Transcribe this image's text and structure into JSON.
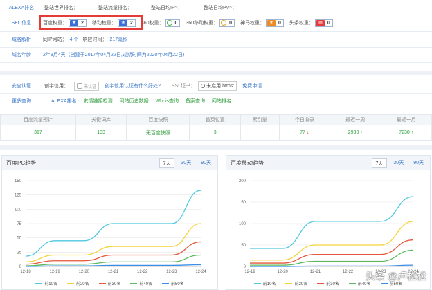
{
  "alexa": {
    "label": "ALEXA排名",
    "items": [
      "整站世界排名：",
      "整站流量排名：",
      "整站日均IP≈：",
      "整站日均PV≈："
    ]
  },
  "seo": {
    "label": "SEO信息",
    "baidu_label": "百度权重：",
    "baidu_value": "2",
    "mobile_label": "移动权重：",
    "mobile_value": "2",
    "so_label": "360权重：",
    "so_value": "0",
    "so_mobile_label": "360移动权重：",
    "so_mobile_value": "0",
    "shenma_label": "神马权重：",
    "shenma_value": "0",
    "toutiao_label": "头条权重：",
    "toutiao_value": "0"
  },
  "domain_parse": {
    "label": "域名解析",
    "same_ip_label": "同IP网站：",
    "same_ip_value": "4 个",
    "response_label": "响应时间：",
    "response_value": "217毫秒"
  },
  "domain_age": {
    "label": "域名年龄",
    "text": "2年8月4天（创建于2017年04月22日,过期时间为2020年04月22日)"
  },
  "security": {
    "label": "安全认证",
    "credit_label": "创宇信用：",
    "credit_badge": "未认证",
    "credit_link": "创宇信用认证有什么好处?",
    "ssl_label": "SSL证书：",
    "ssl_value": "未启用 https:",
    "ssl_apply": "免费申请"
  },
  "more": {
    "label": "更多查询",
    "links": [
      "ALEXA排名",
      "友情链接检测",
      "网站历史数据",
      "Whois查询",
      "备案查询",
      "网站排名"
    ]
  },
  "stats": {
    "headers": [
      "百度流量预计",
      "关键词库",
      "百度快照",
      "首页位置",
      "索引量",
      "今日收录",
      "最近一周",
      "最近一月"
    ],
    "values": [
      "317",
      "133",
      "无百度快照",
      "3",
      "-",
      "77",
      "2930",
      "7230"
    ]
  },
  "colors": {
    "s1": "#4fc8e0",
    "s2": "#f4d33b",
    "s3": "#e5563a",
    "s4": "#5cb85c",
    "s5": "#3a8ee6"
  },
  "pc_panel": {
    "title": "百度PC趋势",
    "tabs": [
      "7天",
      "30天",
      "90天"
    ]
  },
  "mobile_panel": {
    "title": "百度移动趋势",
    "tabs": [
      "7天",
      "30天",
      "90天"
    ]
  },
  "chart_data": [
    {
      "type": "line",
      "title": "百度PC趋势",
      "categories": [
        "12-18",
        "12-19",
        "12-20",
        "12-21",
        "12-22",
        "12-23",
        "12-24"
      ],
      "ylim": [
        0,
        150
      ],
      "yticks": [
        0,
        25,
        50,
        75,
        100,
        125,
        150
      ],
      "series": [
        {
          "name": "前10名",
          "values": [
            18,
            45,
            45,
            75,
            75,
            75,
            133
          ]
        },
        {
          "name": "前20名",
          "values": [
            8,
            20,
            20,
            35,
            35,
            35,
            75
          ]
        },
        {
          "name": "前30名",
          "values": [
            4,
            10,
            10,
            20,
            20,
            20,
            43
          ]
        },
        {
          "name": "前40名",
          "values": [
            1,
            4,
            4,
            8,
            8,
            8,
            20
          ]
        },
        {
          "name": "前50名",
          "values": [
            0,
            1,
            1,
            2,
            2,
            2,
            3
          ]
        }
      ]
    },
    {
      "type": "line",
      "title": "百度移动趋势",
      "categories": [
        "12-19",
        "12-20",
        "12-21",
        "12-22",
        "12-23",
        "12-24"
      ],
      "ylim": [
        0,
        200
      ],
      "yticks": [
        0,
        50,
        100,
        150,
        200
      ],
      "series": [
        {
          "name": "前10名",
          "values": [
            42,
            42,
            105,
            105,
            105,
            163
          ]
        },
        {
          "name": "前20名",
          "values": [
            15,
            15,
            50,
            50,
            50,
            105
          ]
        },
        {
          "name": "前30名",
          "values": [
            8,
            8,
            28,
            28,
            28,
            62
          ]
        },
        {
          "name": "前40名",
          "values": [
            3,
            3,
            12,
            12,
            12,
            38
          ]
        },
        {
          "name": "前50名",
          "values": [
            0,
            0,
            1,
            1,
            1,
            3
          ]
        }
      ]
    }
  ],
  "watermark": "头条 @卢松松"
}
